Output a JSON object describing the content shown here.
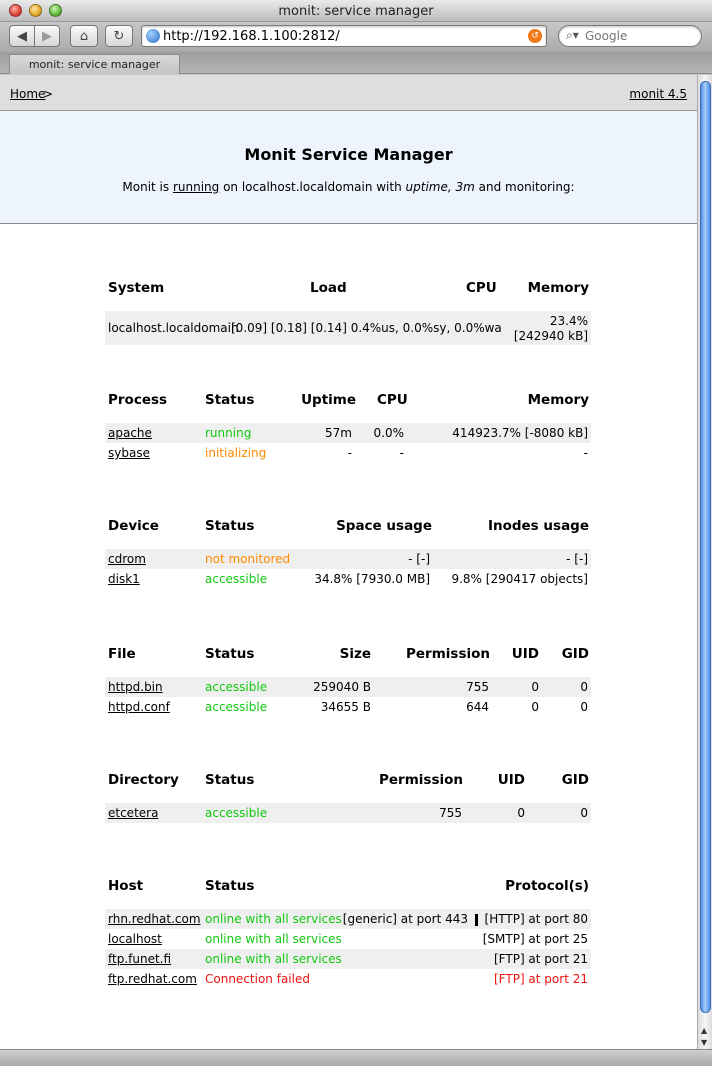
{
  "window": {
    "title": "monit: service manager"
  },
  "toolbar": {
    "url": "http://192.168.1.100:2812/",
    "search_placeholder": "Google",
    "tab_label": "monit: service manager"
  },
  "nav": {
    "home": "Home",
    "separator": ">",
    "version": "monit 4.5"
  },
  "banner": {
    "title": "Monit Service Manager",
    "line_prefix": "Monit is ",
    "running": "running",
    "line_mid": " on localhost.localdomain with ",
    "uptime_label": "uptime,",
    "uptime_value": "3m",
    "line_suffix": " and monitoring:"
  },
  "system": {
    "headers": {
      "system": "System",
      "load": "Load",
      "cpu": "CPU",
      "memory": "Memory"
    },
    "row": {
      "host": "localhost.localdomain",
      "load_cpu": "[0.09] [0.18] [0.14]  0.4%us, 0.0%sy, 0.0%wa",
      "memory_pct": "23.4%",
      "memory_kb": "[242940 kB]"
    }
  },
  "process": {
    "headers": {
      "name": "Process",
      "status": "Status",
      "uptime": "Uptime",
      "cpu": "CPU",
      "memory": "Memory"
    },
    "rows": [
      {
        "name": "apache",
        "status": "running",
        "uptime": "57m",
        "cpu": "0.0%",
        "memory": "414923.7% [-8080 kB]"
      },
      {
        "name": "sybase",
        "status": "initializing",
        "uptime": "-",
        "cpu": "-",
        "memory": "-"
      }
    ]
  },
  "device": {
    "headers": {
      "name": "Device",
      "status": "Status",
      "space": "Space usage",
      "inodes": "Inodes usage"
    },
    "rows": [
      {
        "name": "cdrom",
        "status": "not monitored",
        "space": "- [-]",
        "inodes": "- [-]"
      },
      {
        "name": "disk1",
        "status": "accessible",
        "space": "34.8% [7930.0 MB]",
        "inodes": "9.8% [290417 objects]"
      }
    ]
  },
  "file": {
    "headers": {
      "name": "File",
      "status": "Status",
      "size": "Size",
      "permission": "Permission",
      "uid": "UID",
      "gid": "GID"
    },
    "rows": [
      {
        "name": "httpd.bin",
        "status": "accessible",
        "size": "259040 B",
        "permission": "755",
        "uid": "0",
        "gid": "0"
      },
      {
        "name": "httpd.conf",
        "status": "accessible",
        "size": "34655 B",
        "permission": "644",
        "uid": "0",
        "gid": "0"
      }
    ]
  },
  "directory": {
    "headers": {
      "name": "Directory",
      "status": "Status",
      "permission": "Permission",
      "uid": "UID",
      "gid": "GID"
    },
    "rows": [
      {
        "name": "etcetera",
        "status": "accessible",
        "permission": "755",
        "uid": "0",
        "gid": "0"
      }
    ]
  },
  "host": {
    "headers": {
      "name": "Host",
      "status": "Status",
      "protocols": "Protocol(s)"
    },
    "rows": [
      {
        "name": "rhn.redhat.com",
        "status": "online with all services",
        "protocol_a": "[generic] at port 443",
        "protocol_b": "[HTTP] at port 80"
      },
      {
        "name": "localhost",
        "status": "online with all services",
        "protocol_b": "[SMTP] at port 25"
      },
      {
        "name": "ftp.funet.fi",
        "status": "online with all services",
        "protocol_b": "[FTP] at port 21"
      },
      {
        "name": "ftp.redhat.com",
        "status": "Connection failed",
        "protocol_b": "[FTP] at port 21"
      }
    ]
  },
  "colors": {
    "ok": "#11c911",
    "warn": "#ff8a00",
    "error": "#ee1111",
    "banner_bg": "#eef4fd"
  }
}
